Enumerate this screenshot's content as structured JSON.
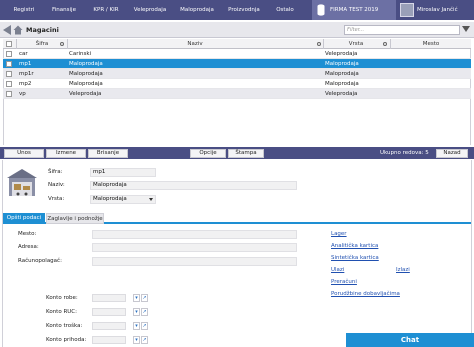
{
  "nav": {
    "items": [
      "Registri",
      "Finansije",
      "KPR / KIR",
      "Veleprodaja",
      "Maloprodaja",
      "Proizvodnja",
      "Ostalo"
    ],
    "firm": "FIRMA TEST 2019",
    "user": "Miroslav Jančić"
  },
  "page": {
    "title": "Magacini",
    "filter_placeholder": "Filter..."
  },
  "table": {
    "columns": [
      "Šifra",
      "Naziv",
      "Vrsta",
      "Mesto"
    ],
    "rows": [
      {
        "sifra": "car",
        "naziv": "Carinski",
        "vrsta": "Veleprodaja",
        "mesto": ""
      },
      {
        "sifra": "mp1",
        "naziv": "Maloprodaja",
        "vrsta": "Maloprodaja",
        "mesto": ""
      },
      {
        "sifra": "mp1r",
        "naziv": "Maloprodaja",
        "vrsta": "Maloprodaja",
        "mesto": ""
      },
      {
        "sifra": "mp2",
        "naziv": "Maloprodaja",
        "vrsta": "Maloprodaja",
        "mesto": ""
      },
      {
        "sifra": "vp",
        "naziv": "Veleprodaja",
        "vrsta": "Veleprodaja",
        "mesto": ""
      }
    ],
    "selected_index": 1
  },
  "actions": {
    "unos": "Unos",
    "izmene": "Izmene",
    "brisanje": "Brisanje",
    "opcije": "Opcije",
    "stampa": "Štampa",
    "total": "Ukupno redova: 5",
    "nazad": "Nazad"
  },
  "form": {
    "sifra_label": "Šifra:",
    "sifra_value": "mp1",
    "naziv_label": "Naziv:",
    "naziv_value": "Maloprodaja",
    "vrsta_label": "Vrsta:",
    "vrsta_value": "Maloprodaja"
  },
  "tabs": [
    "Opšti podaci",
    "Zaglavlje i podnožje"
  ],
  "details": {
    "mesto_label": "Mesto:",
    "adresa_label": "Adresa:",
    "racun_label": "Računopolagač:",
    "konto_robe": "Konto robe:",
    "konto_ruc": "Konto RUC:",
    "konto_troska": "Konto troška:",
    "konto_prihoda": "Konto prihoda:"
  },
  "links": {
    "lager": "Lager",
    "analiticka": "Analitička kartica",
    "sinteticka": "Sintetička kartica",
    "ulazi": "Ulazi",
    "izlazi": "Izlazi",
    "prestrucijaj": "Preračuni",
    "porudzbine": "Porudžbine dobavljačima"
  },
  "chat": "Chat",
  "colors": {
    "nav": "#4a4e84",
    "accent": "#1e8fd3",
    "selected_row": "#1e8fd3"
  }
}
